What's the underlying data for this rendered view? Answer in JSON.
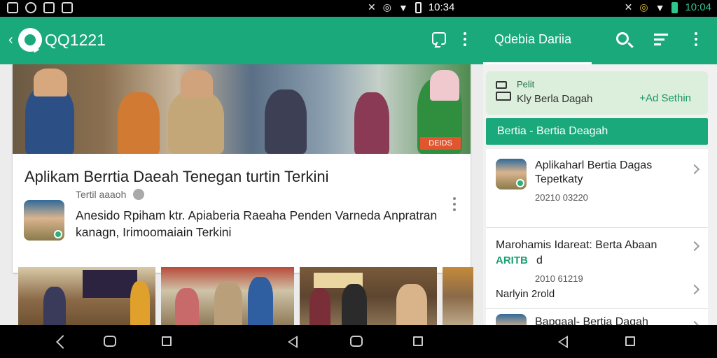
{
  "status_bar": {
    "left_icons": [
      "image-icon",
      "settings-icon",
      "gallery-icon",
      "picture-icon"
    ],
    "time_center": "10:34",
    "time_right": "10:04"
  },
  "left_app": {
    "title": "QQ1221",
    "feature": {
      "headline": "Aplikam Berrtia Daeah Tenegan turtin Terkini",
      "meta": "Tertil aaaoh",
      "summary": "Anesido Rpiham ktr. Apiaberia Raeaha Penden Varneda Anpratran kanagn, Irimoomaiain Terkini",
      "photo_badge": "DEIDS"
    },
    "thumbnails": [
      {
        "label": "news-photo-1"
      },
      {
        "label": "news-photo-2"
      },
      {
        "label": "news-photo-3"
      },
      {
        "label": "news-photo-4"
      }
    ]
  },
  "right_app": {
    "title": "Qdebia Dariia",
    "alert": {
      "label": "Pelit",
      "text": "Kly Berla Dagah",
      "action": "+Ad Sethin"
    },
    "section_header": "Bertia - Bertia Deagah",
    "list_items": [
      {
        "title": "Aplikaharl Bertia Dagas Tepetkaty",
        "subtitle": "20210 03220"
      },
      {
        "title": "Marohamis Idareat: Berta Abaan",
        "accent": "ARITB",
        "accent_suffix": "d",
        "subtitle": "2010 61219"
      },
      {
        "title": "Narlyin 2rold"
      },
      {
        "title": "Bapgaal- Bertia Dagah Terinacay"
      }
    ]
  },
  "colors": {
    "accent": "#1aa97a",
    "accent_light": "#dcefdc",
    "status_bar": "#000000"
  }
}
